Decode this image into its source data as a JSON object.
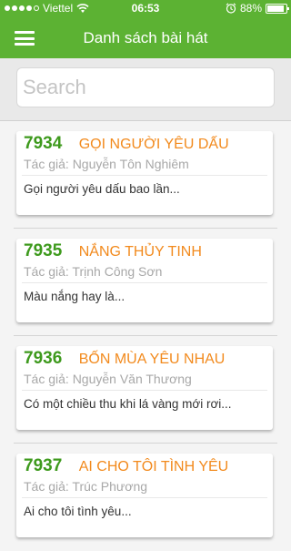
{
  "status_bar": {
    "carrier": "Viettel",
    "time": "06:53",
    "battery": "88%",
    "battery_level": 0.88
  },
  "header": {
    "title": "Danh sách bài hát",
    "menu_icon": "hamburger-menu-icon"
  },
  "search": {
    "placeholder": "Search",
    "value": ""
  },
  "songs": [
    {
      "number": "7934",
      "title": "GỌI NGƯỜI YÊU DẤU",
      "author": "Tác giả: Nguyễn Tôn Nghiêm",
      "preview": "Gọi người yêu dấu bao lần..."
    },
    {
      "number": "7935",
      "title": "NẮNG THỦY TINH",
      "author": "Tác giả: Trịnh Công Sơn",
      "preview": "Màu nắng hay là..."
    },
    {
      "number": "7936",
      "title": "BỐN MÙA YÊU NHAU",
      "author": "Tác giả: Nguyễn Văn Thương",
      "preview": "Có một chiều thu khi lá vàng mới rơi..."
    },
    {
      "number": "7937",
      "title": "AI CHO TÔI TÌNH YÊU",
      "author": "Tác giả: Trúc Phương",
      "preview": "Ai cho tôi tình yêu..."
    }
  ],
  "colors": {
    "header_green": "#5cb233",
    "number_green": "#3e9a1d",
    "title_orange": "#f28a1d"
  }
}
